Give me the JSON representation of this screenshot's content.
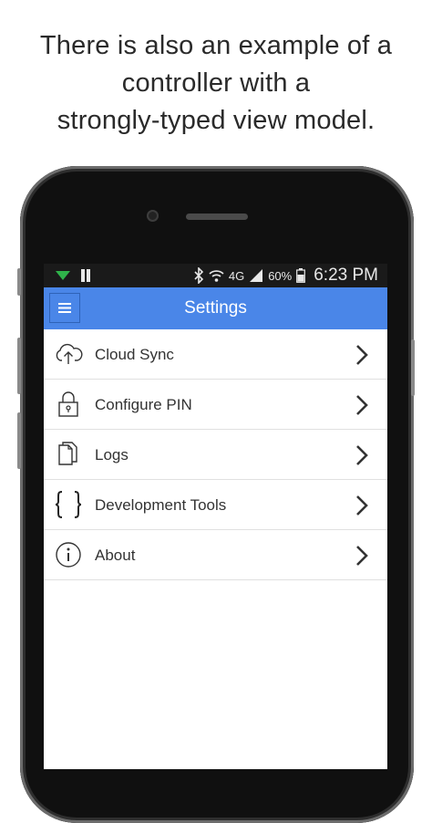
{
  "caption": {
    "line1": "There is also an example of a",
    "line2": "controller with a",
    "line3": "strongly-typed view model."
  },
  "status_bar": {
    "network": "4G",
    "battery": "60%",
    "time": "6:23 PM"
  },
  "app_bar": {
    "title": "Settings",
    "menu_icon": "hamburger-icon"
  },
  "settings_items": [
    {
      "label": "Cloud Sync",
      "icon": "cloud-upload-icon"
    },
    {
      "label": "Configure PIN",
      "icon": "lock-icon"
    },
    {
      "label": "Logs",
      "icon": "documents-icon"
    },
    {
      "label": "Development Tools",
      "icon": "braces-icon"
    },
    {
      "label": "About",
      "icon": "info-icon"
    }
  ],
  "colors": {
    "app_bar": "#4a86e8",
    "status_bar": "#1a1a1a",
    "accent_green": "#2fb34a"
  }
}
